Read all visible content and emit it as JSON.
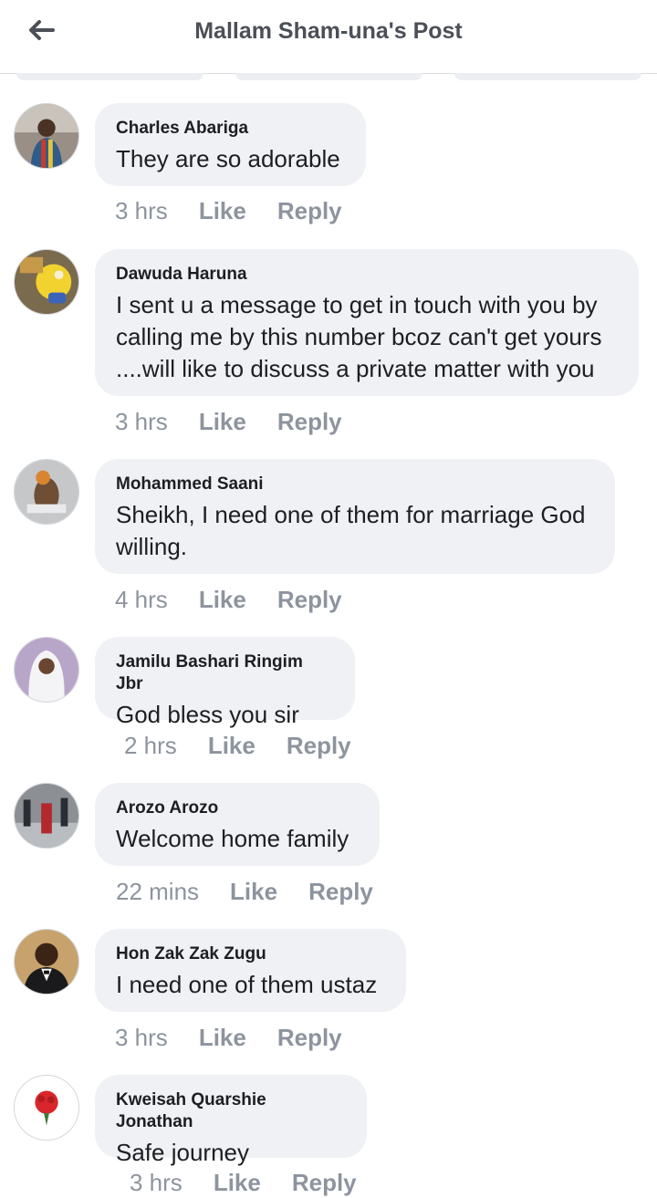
{
  "header": {
    "title": "Mallam Sham-una's Post",
    "back_icon": "arrow-left-icon"
  },
  "comments": [
    {
      "name": "Charles Abariga",
      "text": "They are so adorable",
      "time": "3 hrs",
      "like": "Like",
      "reply": "Reply"
    },
    {
      "name": "Dawuda Haruna",
      "text": "I sent u a message to get in touch with you by\ncalling me by this number bcoz can't get yours\n....will like to discuss a private matter with you",
      "time": "3 hrs",
      "like": "Like",
      "reply": "Reply"
    },
    {
      "name": "Mohammed Saani",
      "text": "Sheikh, I need one of them for marriage God\nwilling.",
      "time": "4 hrs",
      "like": "Like",
      "reply": "Reply"
    },
    {
      "name": "Jamilu Bashari Ringim Jbr",
      "text": "God bless you sir",
      "time": "2 hrs",
      "like": "Like",
      "reply": "Reply"
    },
    {
      "name": "Arozo Arozo",
      "text": "Welcome home family",
      "time": "22 mins",
      "like": "Like",
      "reply": "Reply"
    },
    {
      "name": "Hon Zak Zak Zugu",
      "text": "I need one of them ustaz",
      "time": "3 hrs",
      "like": "Like",
      "reply": "Reply"
    },
    {
      "name": "Kweisah Quarshie Jonathan",
      "text": "Safe journey",
      "time": "3 hrs",
      "like": "Like",
      "reply": "Reply"
    }
  ]
}
